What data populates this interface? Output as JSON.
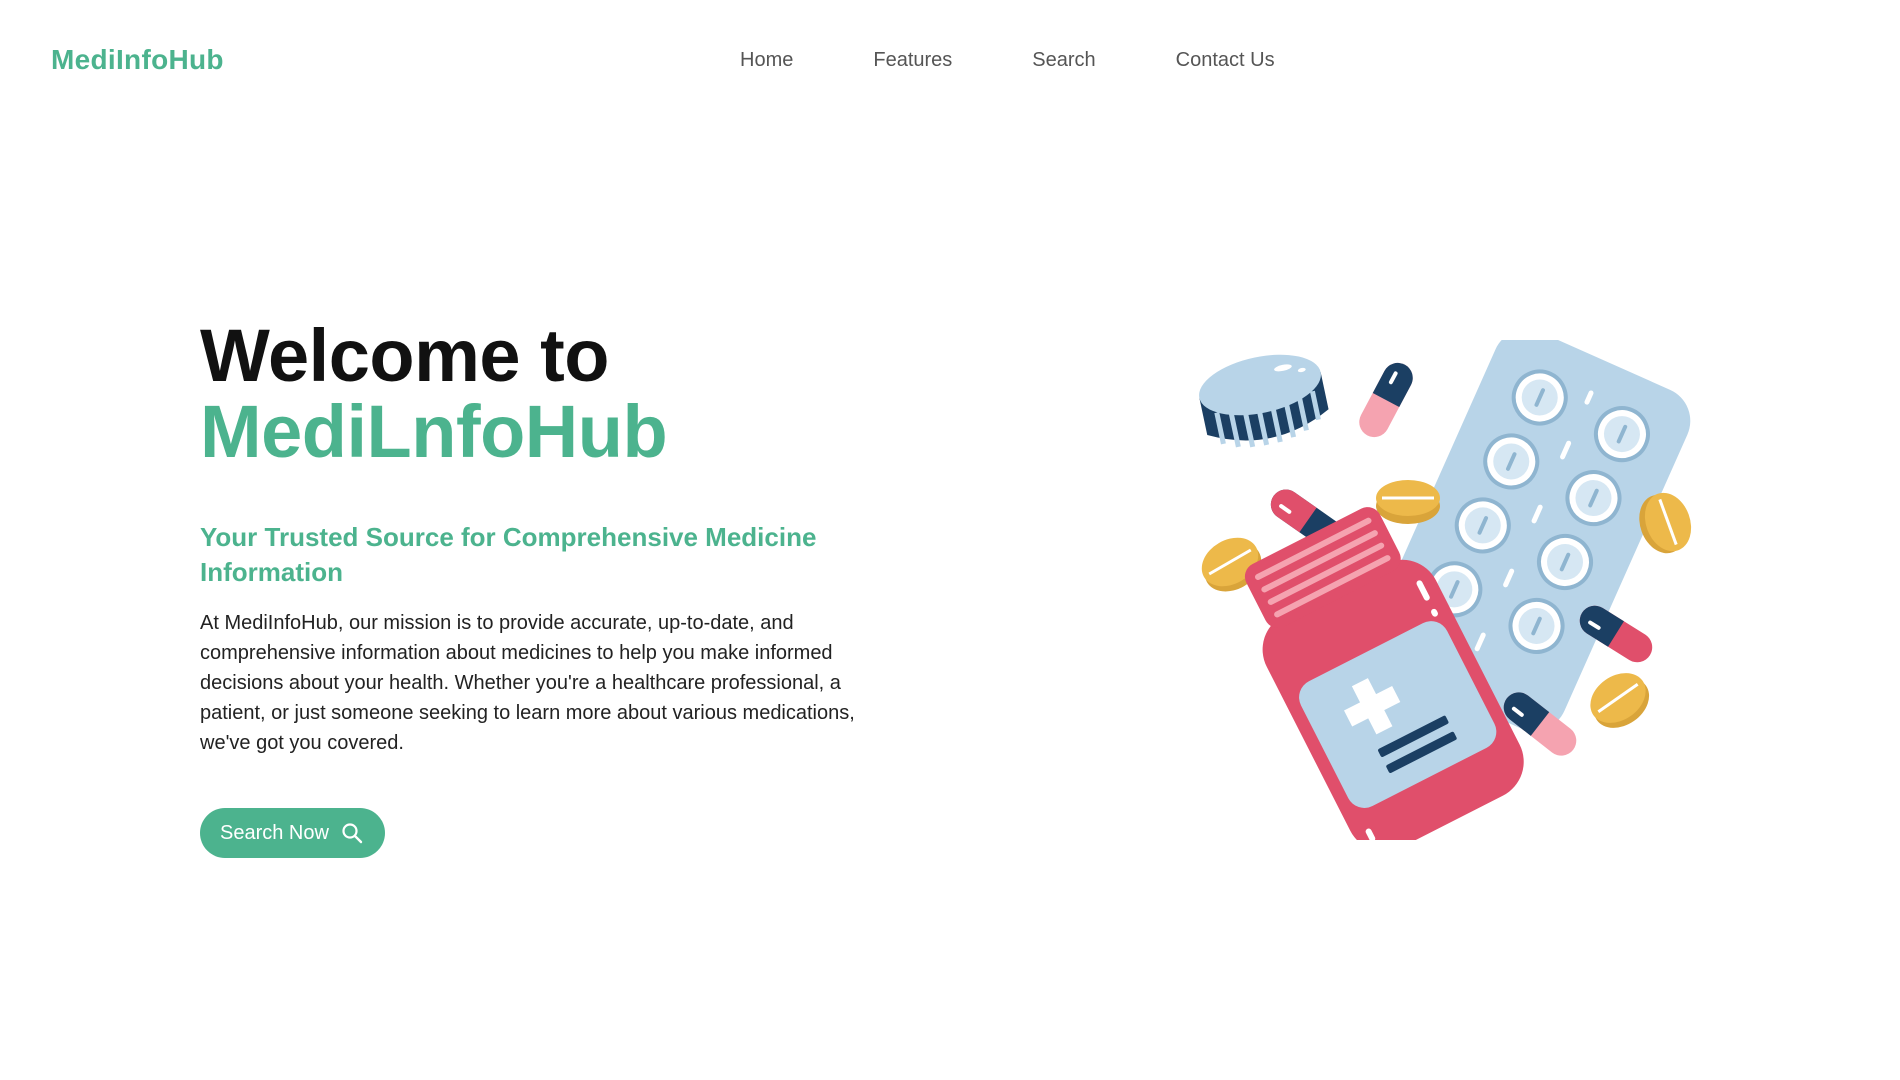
{
  "header": {
    "logo": "MediInfoHub",
    "nav": [
      {
        "label": "Home"
      },
      {
        "label": "Features"
      },
      {
        "label": "Search"
      },
      {
        "label": "Contact Us"
      }
    ]
  },
  "hero": {
    "title_line1": "Welcome to",
    "title_line2": "MediLnfoHub",
    "subtitle": "Your Trusted Source for Comprehensive Medicine Information",
    "body": "At MediInfoHub, our mission is to provide accurate, up-to-date, and comprehensive information about medicines to help you make informed decisions about your health. Whether you're a healthcare professional, a patient, or just someone seeking to learn more about various medications, we've got you covered.",
    "cta_label": "Search Now",
    "cta_icon": "search-icon"
  },
  "illustration": {
    "subject": "medicine-bottle-pills-illustration"
  },
  "colors": {
    "brand": "#4cb38e",
    "text": "#111111",
    "nav": "#555555",
    "bottle": "#e04f6b",
    "blister": "#b8d4e8",
    "navy": "#1b3f63",
    "pill_yellow": "#edb94a",
    "pill_pink": "#f5a3b0"
  }
}
